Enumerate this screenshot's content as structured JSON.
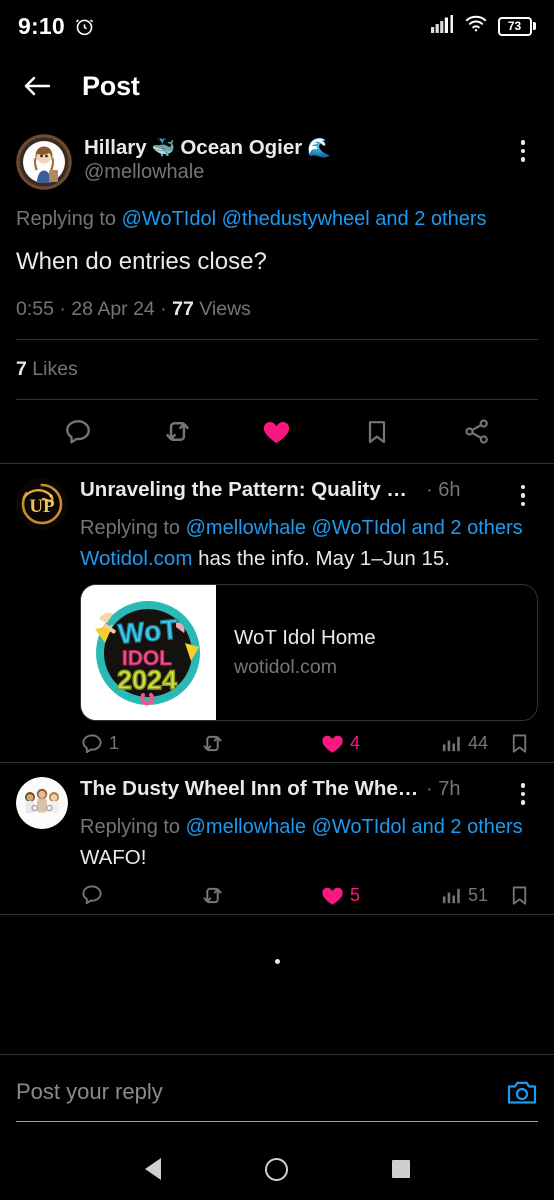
{
  "status_bar": {
    "time": "9:10",
    "alarm_icon": "alarm-icon",
    "signal_icon": "cellular-signal-icon",
    "wifi_icon": "wifi-icon",
    "battery_level": "73"
  },
  "header": {
    "back_icon": "arrow-left-icon",
    "title": "Post"
  },
  "main_tweet": {
    "avatar_alt": "mellowhale-avatar",
    "display_name": "Hillary",
    "name_emoji_1": "🐳",
    "display_name_2": "Ocean Ogier",
    "name_emoji_2": "🌊",
    "handle": "@mellowhale",
    "more_icon": "more-options-icon",
    "replying_prefix": "Replying to ",
    "replying_mentions": "@WoTIdol @thedustywheel",
    "replying_suffix": " and 2 others",
    "body": "When do entries close?",
    "time": "0:55",
    "meta_sep_1": " · ",
    "date": "28 Apr 24",
    "meta_sep_2": " · ",
    "views_count": "77",
    "views_label": " Views",
    "likes_count": "7",
    "likes_label": " Likes",
    "actions": {
      "reply_icon": "reply-icon",
      "retweet_icon": "retweet-icon",
      "like_icon": "like-heart-icon",
      "bookmark_icon": "bookmark-icon",
      "share_icon": "share-icon",
      "liked": true
    }
  },
  "replies": [
    {
      "avatar_alt": "unraveling-the-pattern-avatar",
      "avatar_type": "up-logo",
      "display_name": "Unraveling the Pattern: Quality Wo...",
      "timestamp": "· 6h",
      "more_icon": "more-options-icon",
      "replying_prefix": "Replying to ",
      "replying_mentions": "@mellowhale @WoTIdol and 2 others",
      "body_link": "Wotidol.com",
      "body_rest": " has the info. May 1–Jun 15.",
      "card": {
        "image_alt": "wot-idol-2024-logo",
        "logo_text_1": "WoT",
        "logo_text_2": "IDOL",
        "logo_text_3": "2024",
        "title": "WoT Idol Home",
        "domain": "wotidol.com"
      },
      "metrics": {
        "reply_count": "1",
        "retweet_count": "",
        "like_count": "4",
        "views_count": "44",
        "liked": true
      }
    },
    {
      "avatar_alt": "the-dusty-wheel-avatar",
      "avatar_type": "dusty-wheel",
      "display_name": "The Dusty Wheel Inn of The Wheel...",
      "timestamp": "· 7h",
      "more_icon": "more-options-icon",
      "replying_prefix": "Replying to ",
      "replying_mentions": "@mellowhale @WoTIdol and 2 others",
      "body_link": "",
      "body_rest": "WAFO!",
      "metrics": {
        "reply_count": "",
        "retweet_count": "",
        "like_count": "5",
        "views_count": "51",
        "liked": true
      }
    }
  ],
  "loading_indicator": "loading-dot",
  "composer": {
    "placeholder": "Post your reply",
    "camera_icon": "camera-icon"
  },
  "nav_bar": {
    "back_icon": "nav-back-icon",
    "home_icon": "nav-home-icon",
    "recents_icon": "nav-recents-icon"
  },
  "colors": {
    "accent_blue": "#1d9bf0",
    "like_pink": "#f91880",
    "text_primary": "#e7e9ea",
    "text_secondary": "#71767b",
    "divider": "#2f3336"
  }
}
